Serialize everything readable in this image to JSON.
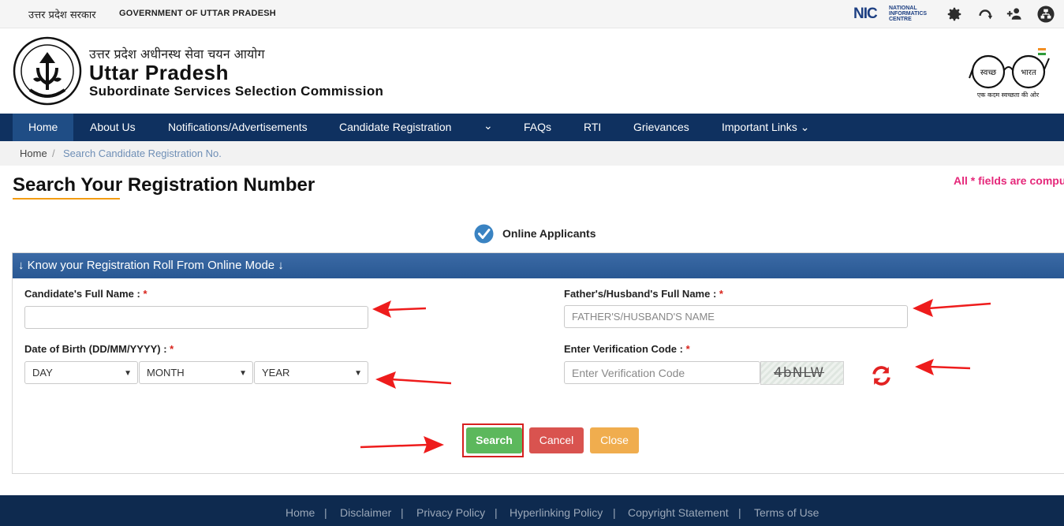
{
  "topbar": {
    "hindi_gov": "उत्तर प्रदेश सरकार",
    "english_gov": "GOVERNMENT OF UTTAR PRADESH",
    "nic_mark": "NIC",
    "nic_line1": "NATIONAL",
    "nic_line2": "INFORMATICS",
    "nic_line3": "CENTRE",
    "icons": [
      "gear-icon",
      "headset-icon",
      "add-user-icon",
      "sitemap-icon"
    ]
  },
  "header": {
    "hindi_title": "उत्तर प्रदेश अधीनस्थ सेवा चयन आयोग",
    "title": "Uttar Pradesh",
    "subtitle": "Subordinate Services Selection Commission",
    "emblem_text": "उत्तर प्रदेश सरकार",
    "swachh_left": "स्वच्छ",
    "swachh_right": "भारत",
    "swachh_tagline": "एक कदम स्वच्छता की ओर"
  },
  "nav": {
    "items": [
      {
        "label": "Home"
      },
      {
        "label": "About Us"
      },
      {
        "label": "Notifications/Advertisements"
      },
      {
        "label": "Candidate Registration"
      },
      {
        "label": "⌄"
      },
      {
        "label": "FAQs"
      },
      {
        "label": "RTI"
      },
      {
        "label": "Grievances"
      },
      {
        "label": "Important Links ⌄"
      }
    ]
  },
  "breadcrumb": {
    "home": "Home",
    "separator": "/",
    "current": "Search Candidate Registration No."
  },
  "page": {
    "title": "Search Your Registration Number",
    "required_note": "All * fields are compulsory",
    "online_label": "Online Applicants"
  },
  "form": {
    "panel_title": "↓ Know your Registration Roll From Online Mode ↓",
    "candidate_name_label": "Candidate's Full Name : ",
    "candidate_name_value": "",
    "father_name_label": "Father's/Husband's Full Name : ",
    "father_name_placeholder": "FATHER'S/HUSBAND'S NAME",
    "dob_label": "Date of Birth (DD/MM/YYYY) : ",
    "day_value": "DAY",
    "month_value": "MONTH",
    "year_value": "YEAR",
    "verification_label": "Enter Verification Code : ",
    "verification_placeholder": "Enter Verification Code",
    "captcha_text": "4bNLW",
    "required_mark": "*"
  },
  "buttons": {
    "search": "Search",
    "cancel": "Cancel",
    "close": "Close"
  },
  "footer": {
    "links": [
      "Home",
      "Disclaimer",
      "Privacy Policy",
      "Hyperlinking Policy",
      "Copyright Statement",
      "Terms of Use"
    ],
    "separator": "|"
  },
  "colors": {
    "nav_bg": "#0f3160",
    "panel_head": "#3b6aa5",
    "search_green": "#5cb85c",
    "cancel_red": "#d9534f",
    "close_orange": "#f0ad4e",
    "required_pink": "#e5287a",
    "annotation_red": "#ee1c1c"
  }
}
